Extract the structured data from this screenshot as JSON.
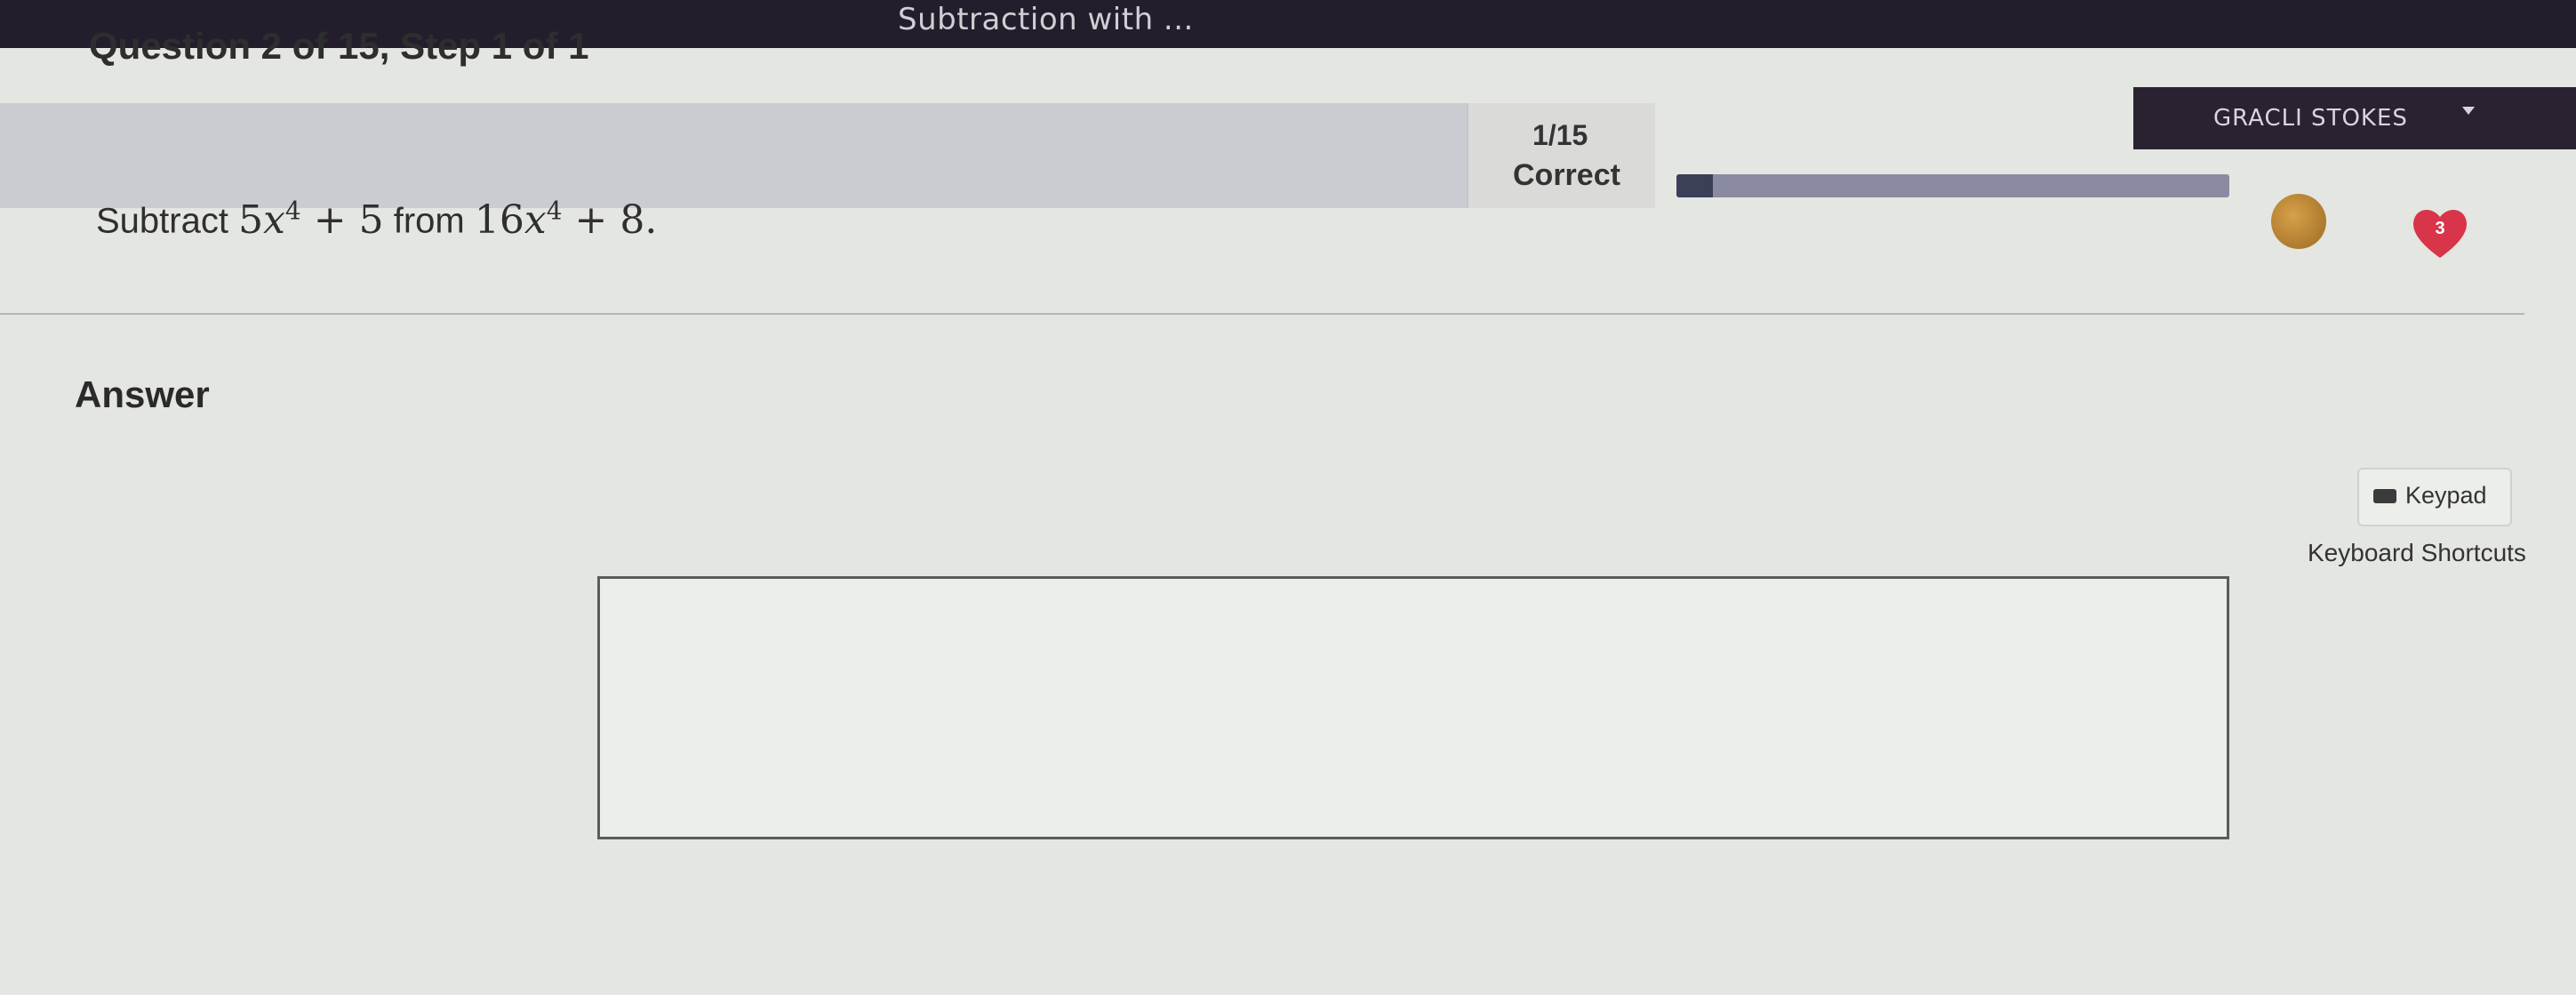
{
  "topbar": {
    "title": "Subtraction with ...",
    "user_name": "GRACLI STOKES"
  },
  "question": {
    "title": "Question 2 of 15, Step 1 of 1",
    "prompt_prefix": "Subtract",
    "term1_coef": "5",
    "term1_var": "x",
    "term1_exp": "4",
    "term1_rest": "+ 5",
    "prompt_mid": "from",
    "term2_coef": "16",
    "term2_var": "x",
    "term2_exp": "4",
    "term2_rest": "+ 8."
  },
  "status": {
    "fraction": "1/15",
    "result": "Correct",
    "progress_fraction": 0.0667
  },
  "badges": {
    "hearts": "3"
  },
  "answer": {
    "label": "Answer",
    "keypad_label": "Keypad",
    "shortcuts_label": "Keyboard Shortcuts",
    "value": ""
  },
  "colors": {
    "topbar": "#241d2c",
    "progress_fill": "#3c3f58",
    "heart": "#d8344a",
    "coin": "#b98434"
  }
}
